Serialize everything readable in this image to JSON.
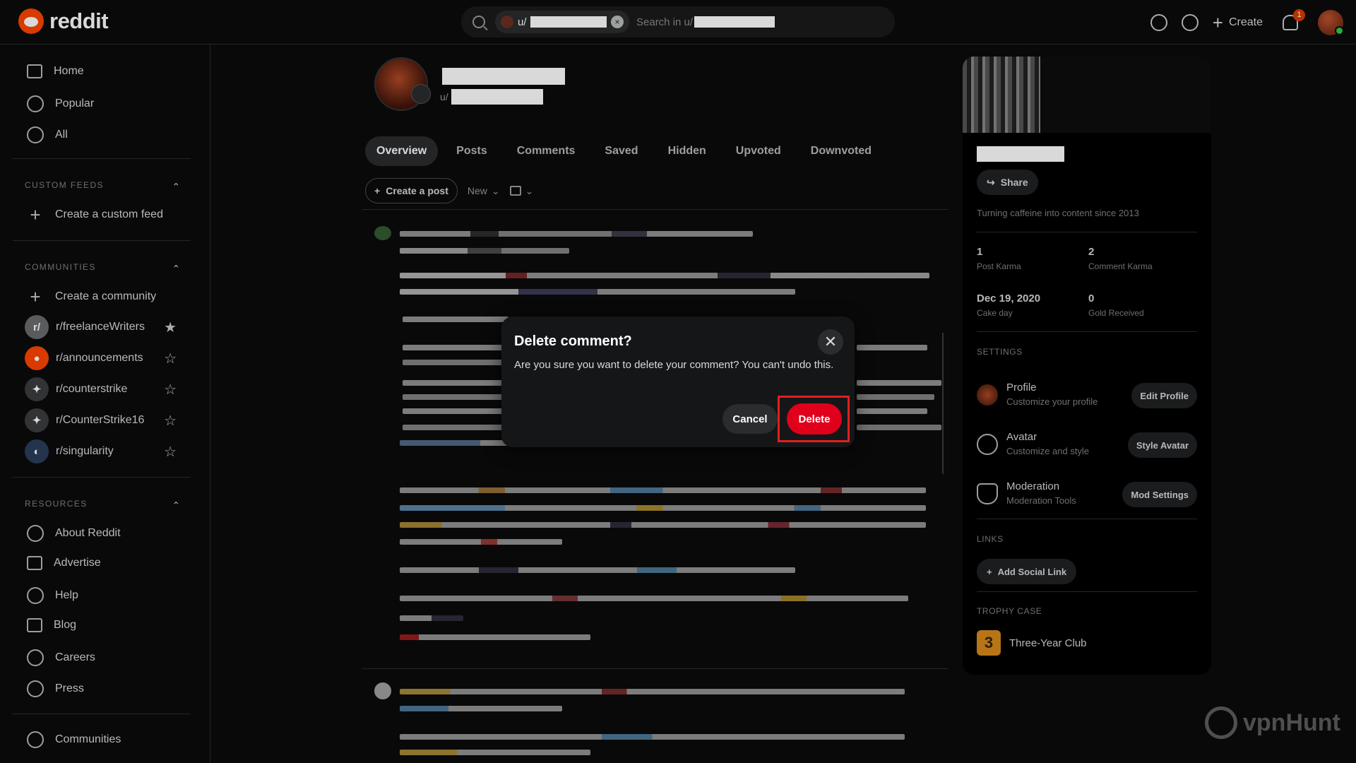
{
  "header": {
    "logo_text": "reddit",
    "search_chip_prefix": "u/",
    "search_placeholder": "Search in u/",
    "create_label": "Create",
    "notification_count": "1"
  },
  "sidebar": {
    "nav": [
      {
        "label": "Home",
        "icon": "home-icon"
      },
      {
        "label": "Popular",
        "icon": "popular-icon"
      },
      {
        "label": "All",
        "icon": "all-icon"
      }
    ],
    "custom_feeds_heading": "CUSTOM FEEDS",
    "create_custom_feed": "Create a custom feed",
    "communities_heading": "COMMUNITIES",
    "create_community": "Create a community",
    "communities": [
      {
        "name": "r/freelanceWriters",
        "starred": true,
        "color": "#6a6c6e"
      },
      {
        "name": "r/announcements",
        "starred": false,
        "color": "#ff4500"
      },
      {
        "name": "r/counterstrike",
        "starred": false,
        "color": "#3a3c3e"
      },
      {
        "name": "r/CounterStrike16",
        "starred": false,
        "color": "#3a3c3e"
      },
      {
        "name": "r/singularity",
        "starred": false,
        "color": "#2a3e5a"
      }
    ],
    "resources_heading": "RESOURCES",
    "resources": [
      {
        "label": "About Reddit"
      },
      {
        "label": "Advertise"
      },
      {
        "label": "Help"
      },
      {
        "label": "Blog"
      },
      {
        "label": "Careers"
      },
      {
        "label": "Press"
      }
    ],
    "communities_link": "Communities"
  },
  "profile": {
    "username_prefix": "u/",
    "tabs": [
      "Overview",
      "Posts",
      "Comments",
      "Saved",
      "Hidden",
      "Upvoted",
      "Downvoted"
    ],
    "active_tab": "Overview",
    "create_post": "Create a post",
    "sort": "New"
  },
  "right_panel": {
    "share": "Share",
    "description": "Turning caffeine into content since 2013",
    "stats": [
      {
        "value": "1",
        "label": "Post Karma"
      },
      {
        "value": "2",
        "label": "Comment Karma"
      },
      {
        "value": "Dec 19, 2020",
        "label": "Cake day"
      },
      {
        "value": "0",
        "label": "Gold Received"
      }
    ],
    "settings_heading": "SETTINGS",
    "settings": [
      {
        "title": "Profile",
        "subtitle": "Customize your profile",
        "button": "Edit Profile"
      },
      {
        "title": "Avatar",
        "subtitle": "Customize and style",
        "button": "Style Avatar"
      },
      {
        "title": "Moderation",
        "subtitle": "Moderation Tools",
        "button": "Mod Settings"
      }
    ],
    "links_heading": "LINKS",
    "add_social_link": "Add Social Link",
    "trophy_heading": "TROPHY CASE",
    "trophy_name": "Three-Year Club",
    "trophy_glyph": "3"
  },
  "modal": {
    "title": "Delete comment?",
    "body": "Are you sure you want to delete your comment? You can't undo this.",
    "cancel": "Cancel",
    "delete": "Delete"
  },
  "watermark": "vpnHunt",
  "colors": {
    "accent": "#ff4500",
    "danger": "#e0001b",
    "highlight": "#e02020"
  }
}
